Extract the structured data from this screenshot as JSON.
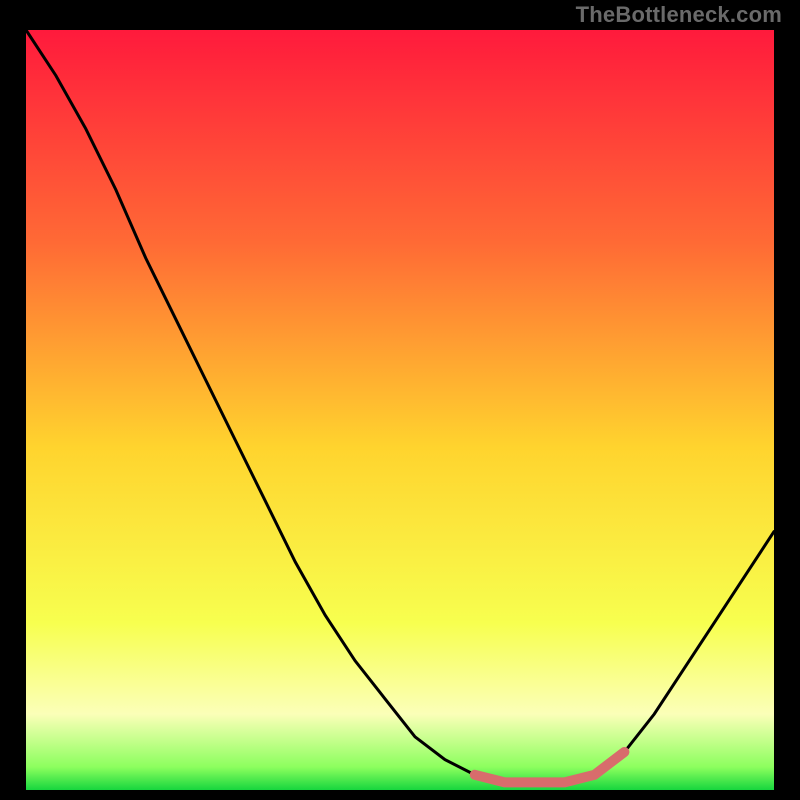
{
  "watermark": "TheBottleneck.com",
  "chart_data": {
    "type": "line",
    "title": "",
    "xlabel": "",
    "ylabel": "",
    "x": [
      0.0,
      0.04,
      0.08,
      0.12,
      0.16,
      0.2,
      0.24,
      0.28,
      0.32,
      0.36,
      0.4,
      0.44,
      0.48,
      0.52,
      0.56,
      0.6,
      0.64,
      0.68,
      0.72,
      0.76,
      0.8,
      0.84,
      0.88,
      0.92,
      0.96,
      1.0
    ],
    "values": [
      1.0,
      0.94,
      0.87,
      0.79,
      0.7,
      0.62,
      0.54,
      0.46,
      0.38,
      0.3,
      0.23,
      0.17,
      0.12,
      0.07,
      0.04,
      0.02,
      0.01,
      0.01,
      0.01,
      0.02,
      0.05,
      0.1,
      0.16,
      0.22,
      0.28,
      0.34
    ],
    "highlight_band": {
      "x_from": 0.58,
      "x_to": 0.8,
      "note": "flat valley zone near y≈0"
    },
    "xlim": [
      0,
      1
    ],
    "ylim": [
      0,
      1
    ],
    "background": "rainbow-gradient red→yellow→green bottom",
    "frame": "black",
    "legend": null
  },
  "colors": {
    "frame": "#000000",
    "curve": "#000000",
    "highlight": "#d86c6c",
    "grad_top": "#ff1a3c",
    "grad_mid1": "#ff8a2a",
    "grad_mid2": "#ffe92e",
    "grad_mid3": "#fdff70",
    "grad_bot": "#17e63e"
  }
}
